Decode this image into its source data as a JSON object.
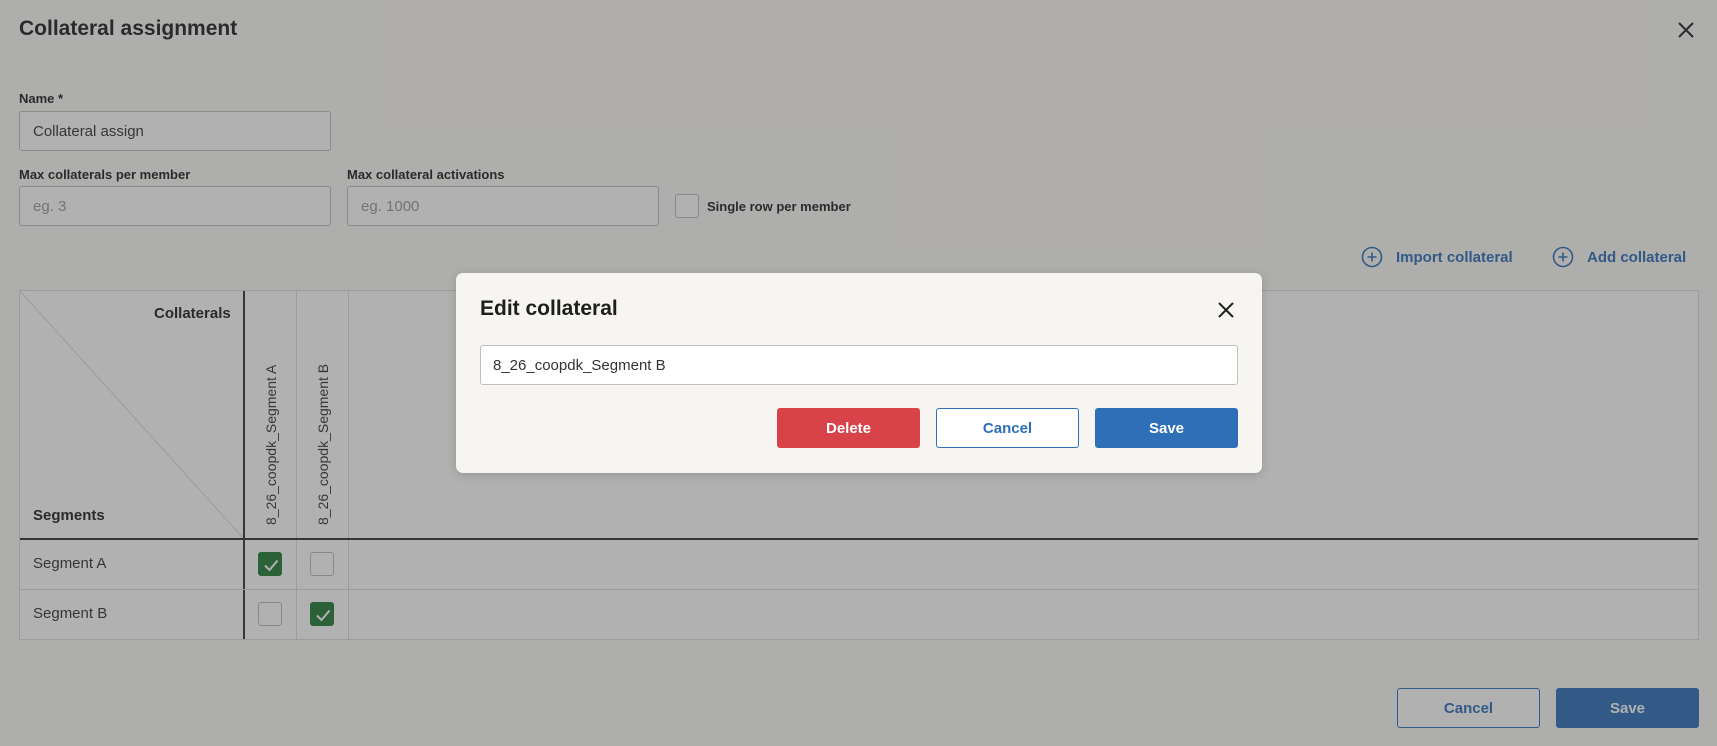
{
  "page": {
    "title": "Collateral assignment",
    "close_icon": "close-icon"
  },
  "form": {
    "name_label": "Name *",
    "name_value": "Collateral assign",
    "max_per_member_label": "Max collaterals per member",
    "max_per_member_placeholder": "eg. 3",
    "max_activations_label": "Max collateral activations",
    "max_activations_placeholder": "eg. 1000",
    "single_row_label": "Single row per member",
    "single_row_checked": false
  },
  "actions": {
    "import_label": "Import collateral",
    "add_label": "Add collateral",
    "icon": "plus-circle-icon"
  },
  "matrix": {
    "collaterals_label": "Collaterals",
    "segments_label": "Segments",
    "columns": [
      "8_26_coopdk_Segment A",
      "8_26_coopdk_Segment B"
    ],
    "rows": [
      {
        "label": "Segment A",
        "checks": [
          true,
          false
        ]
      },
      {
        "label": "Segment B",
        "checks": [
          false,
          true
        ]
      }
    ]
  },
  "footer": {
    "cancel_label": "Cancel",
    "save_label": "Save"
  },
  "modal": {
    "title": "Edit collateral",
    "input_value": "8_26_coopdk_Segment B",
    "delete_label": "Delete",
    "cancel_label": "Cancel",
    "save_label": "Save"
  },
  "colors": {
    "accent": "#2e6fb8",
    "danger": "#d8434a",
    "check": "#1f7a34"
  }
}
